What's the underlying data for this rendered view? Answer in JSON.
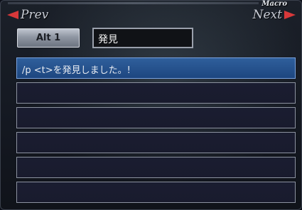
{
  "header": {
    "prev_label": "Prev",
    "next_label": "Next",
    "caption": "Macro",
    "arrow_color": "#d8383a"
  },
  "macro": {
    "set_tab_label": "Alt 1",
    "title": "発見",
    "lines": [
      "/p <t>を発見しました。!",
      "",
      "",
      "",
      "",
      ""
    ],
    "selected_line": 1,
    "selected_color": "#1d4680"
  }
}
